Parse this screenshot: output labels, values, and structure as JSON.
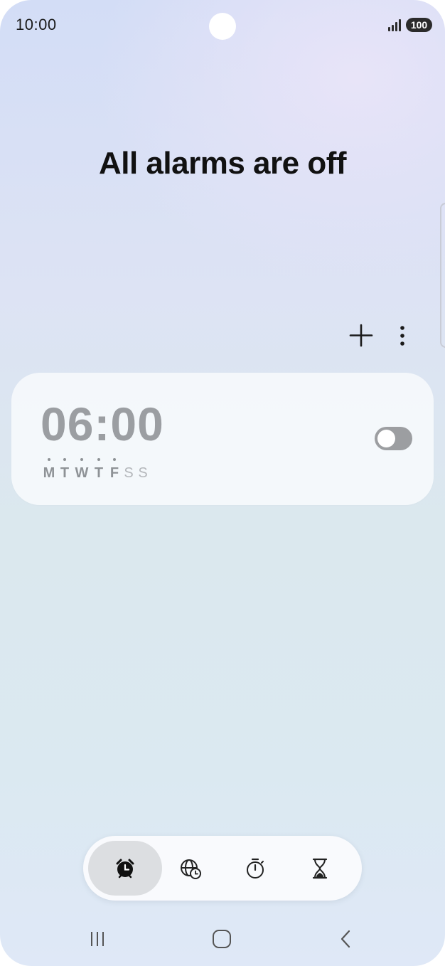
{
  "status_bar": {
    "time": "10:00",
    "battery": "100",
    "signal_icon": "signal-bars-icon"
  },
  "alarm_screen": {
    "headline": "All alarms are off",
    "add_icon": "plus-icon",
    "more_icon": "more-vertical-icon"
  },
  "alarms": [
    {
      "time": "06:00",
      "enabled": false,
      "days": [
        {
          "letter": "M",
          "active": true
        },
        {
          "letter": "T",
          "active": true
        },
        {
          "letter": "W",
          "active": true
        },
        {
          "letter": "T",
          "active": true
        },
        {
          "letter": "F",
          "active": true
        },
        {
          "letter": "S",
          "active": false
        },
        {
          "letter": "S",
          "active": false
        }
      ]
    }
  ],
  "bottom_tabs": [
    {
      "icon": "alarm-clock-icon",
      "active": true
    },
    {
      "icon": "world-clock-icon",
      "active": false
    },
    {
      "icon": "stopwatch-icon",
      "active": false
    },
    {
      "icon": "timer-hourglass-icon",
      "active": false
    }
  ],
  "nav_bar": {
    "recents_icon": "recents-icon",
    "home_icon": "home-icon",
    "back_icon": "back-icon"
  },
  "colors": {
    "accent_text": "#111111",
    "disabled_time": "#9b9ea2",
    "toggle_off": "#9c9ea1"
  }
}
